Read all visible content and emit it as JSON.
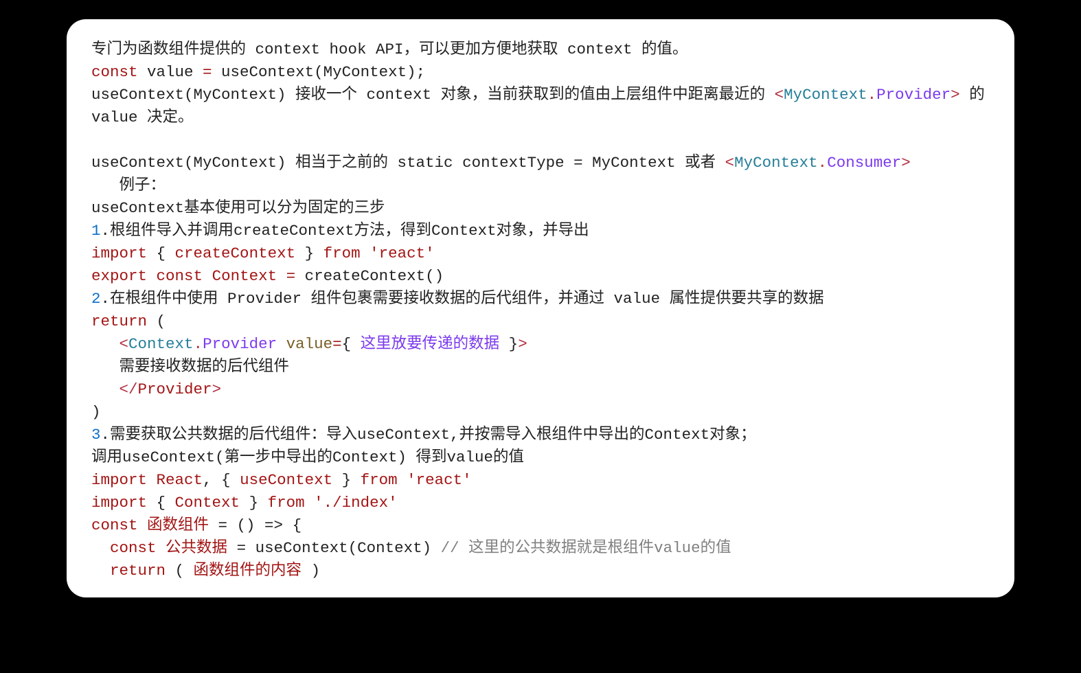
{
  "lines": {
    "l01a": "专门为函数组件提供的 context hook API，可以更加方便地获取 context 的值。",
    "l02_const": "const",
    "l02_value": " value ",
    "l02_eq": "=",
    "l02_fn": " useContext(MyContext);",
    "l03a": "useContext(MyContext) 接收一个 context 对象，当前获取到的值由上层组件中距离最近的 ",
    "l03_lt": "<",
    "l03_tag": "MyContext",
    "l03_dot": ".",
    "l03_prov": "Provider",
    "l03_gt": ">",
    "l03b": " 的 value 决定。",
    "l05a": "useContext(MyContext) 相当于之前的 static contextType = MyContext 或者 ",
    "l05_lt": "<",
    "l05_tag": "MyContext",
    "l05_dot": ".",
    "l05_cons": "Consumer",
    "l05_gt": ">",
    "l06": "   例子：",
    "l07": "useContext基本使用可以分为固定的三步",
    "l08_num": "1",
    "l08_dot": ".",
    "l08_txt": "根组件导入并调用createContext方法，得到Context对象，并导出",
    "l09_kw1": "import",
    "l09_space1": " ",
    "l09_brace1": "{ ",
    "l09_id": "createContext",
    "l09_brace2": " }",
    "l09_space2": " ",
    "l09_kw2": "from",
    "l09_space3": " ",
    "l09_str": "'react'",
    "l10_kw1": "export",
    "l10_sp1": " ",
    "l10_kw2": "const",
    "l10_sp2": " ",
    "l10_id": "Context",
    "l10_sp3": " ",
    "l10_eq": "=",
    "l10_rest": " createContext()",
    "l11_num": "2",
    "l11_dot": ".",
    "l11_txt": "在根组件中使用 Provider 组件包裹需要接收数据的后代组件，并通过 value 属性提供要共享的数据",
    "l12_kw": "return",
    "l12_rest": " (",
    "l13_indent": "   ",
    "l13_lt": "<",
    "l13_tag": "Context",
    "l13_dot": ".",
    "l13_prov": "Provider",
    "l13_sp": " ",
    "l13_attr": "value",
    "l13_eq": "=",
    "l13_b1": "{ ",
    "l13_ph": "这里放要传递的数据",
    "l13_b2": " }",
    "l13_gt": ">",
    "l14": "   需要接收数据的后代组件",
    "l15_indent": "   ",
    "l15_lt": "<",
    "l15_slash": "/",
    "l15_prov": "Provider",
    "l15_gt": ">",
    "l16": ")",
    "l17_num": "3",
    "l17_dot": ".",
    "l17_txt": "需要获取公共数据的后代组件：导入useContext,并按需导入根组件中导出的Context对象；",
    "l18": "调用useContext(第一步中导出的Context) 得到value的值",
    "l19_kw1": "import",
    "l19_sp1": " ",
    "l19_r": "React",
    "l19_c": ", ",
    "l19_b1": "{ ",
    "l19_id": "useContext",
    "l19_b2": " }",
    "l19_sp2": " ",
    "l19_kw2": "from",
    "l19_sp3": " ",
    "l19_str": "'react'",
    "l20_kw1": "import",
    "l20_sp1": " ",
    "l20_b1": "{ ",
    "l20_id": "Context",
    "l20_b2": " }",
    "l20_sp2": " ",
    "l20_kw2": "from",
    "l20_sp3": " ",
    "l20_str": "'./index'",
    "l21_kw": "const",
    "l21_sp": " ",
    "l21_id": "函数组件",
    "l21_rest": " = () => {",
    "l22_indent": "  ",
    "l22_kw": "const",
    "l22_sp": " ",
    "l22_id": "公共数据",
    "l22_rest": " = useContext(Context) ",
    "l22_cmt": "// 这里的公共数据就是根组件value的值",
    "l23_indent": "  ",
    "l23_kw": "return",
    "l23_p1": " ( ",
    "l23_id": "函数组件的内容",
    "l23_p2": " )"
  }
}
